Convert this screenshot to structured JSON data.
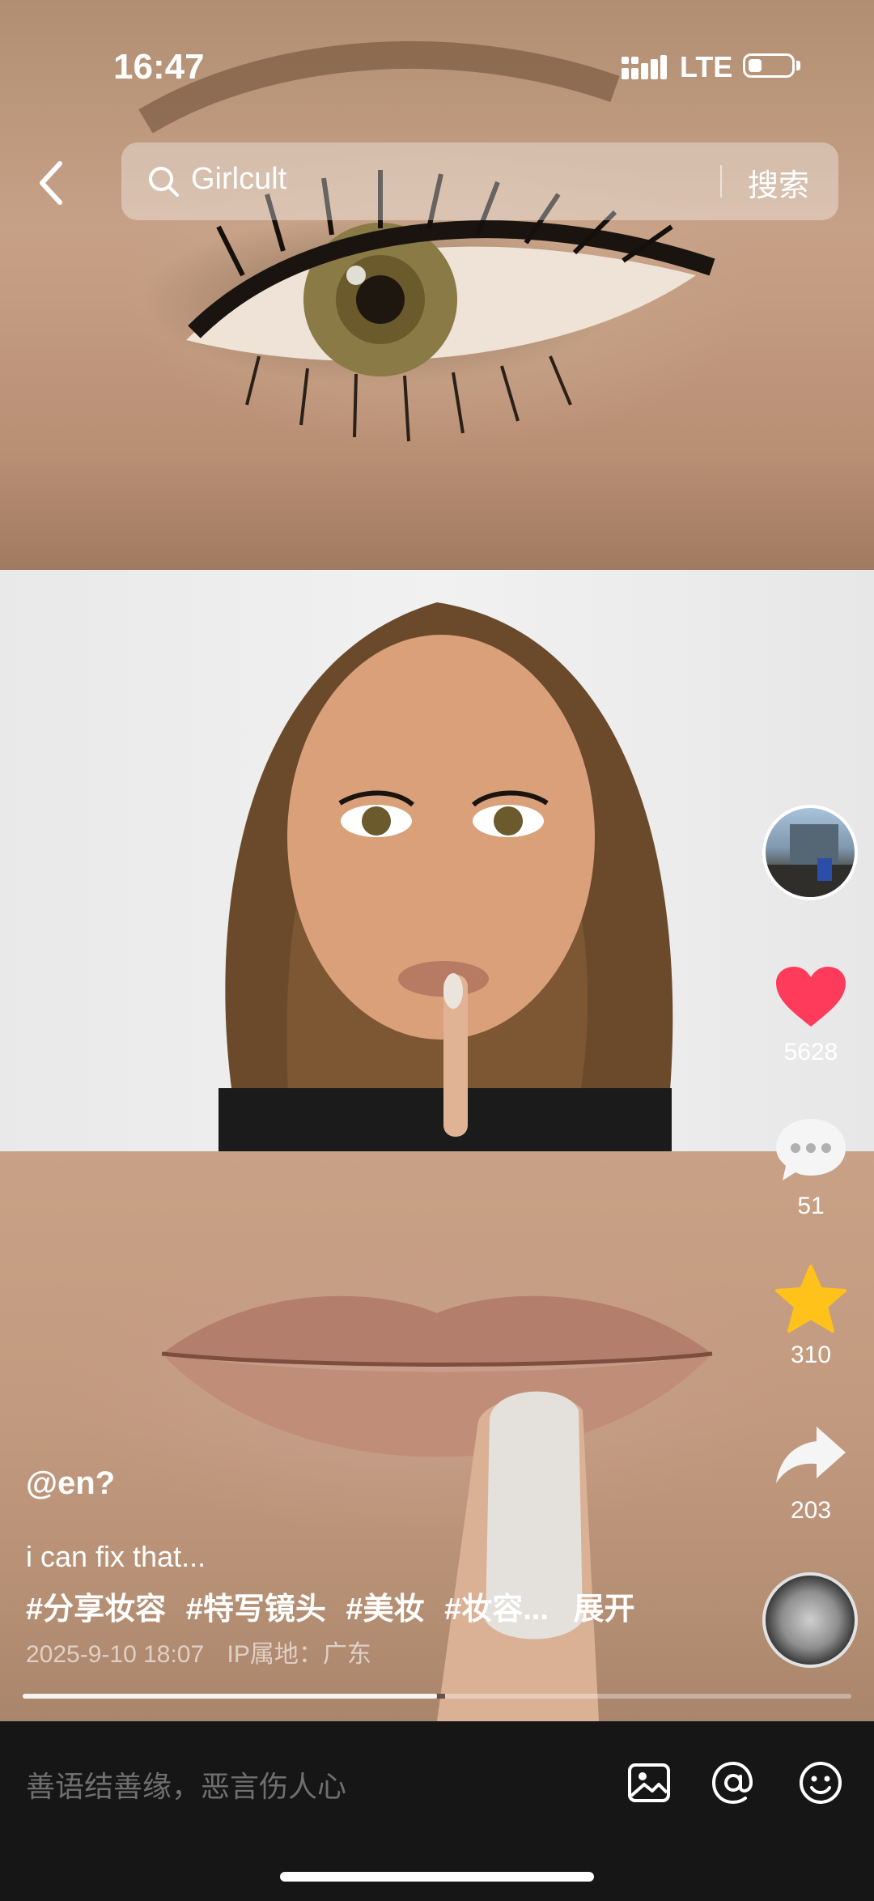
{
  "status_bar": {
    "time": "16:47",
    "network": "LTE"
  },
  "search": {
    "query": "Girlcult",
    "button": "搜索"
  },
  "rail": {
    "likes": "5628",
    "comments": "51",
    "favorites": "310",
    "shares": "203"
  },
  "caption": {
    "author": "@en?",
    "description": "i can fix that...",
    "tags": [
      "#分享妆容",
      "#特写镜头",
      "#美妆",
      "#妆容..."
    ],
    "expand": "展开",
    "date": "2025-9-10 18:07",
    "ip": "IP属地：广东"
  },
  "video": {
    "progress": 0.5
  },
  "comment_bar": {
    "placeholder": "善语结善缘，恶言伤人心"
  },
  "colors": {
    "like": "#ff3b5c",
    "favorite": "#ffc21a",
    "bar_bg": "#161616"
  },
  "icons": [
    "back-icon",
    "search-icon",
    "heart-icon",
    "comment-icon",
    "star-icon",
    "share-icon",
    "image-icon",
    "at-icon",
    "emoji-icon"
  ]
}
